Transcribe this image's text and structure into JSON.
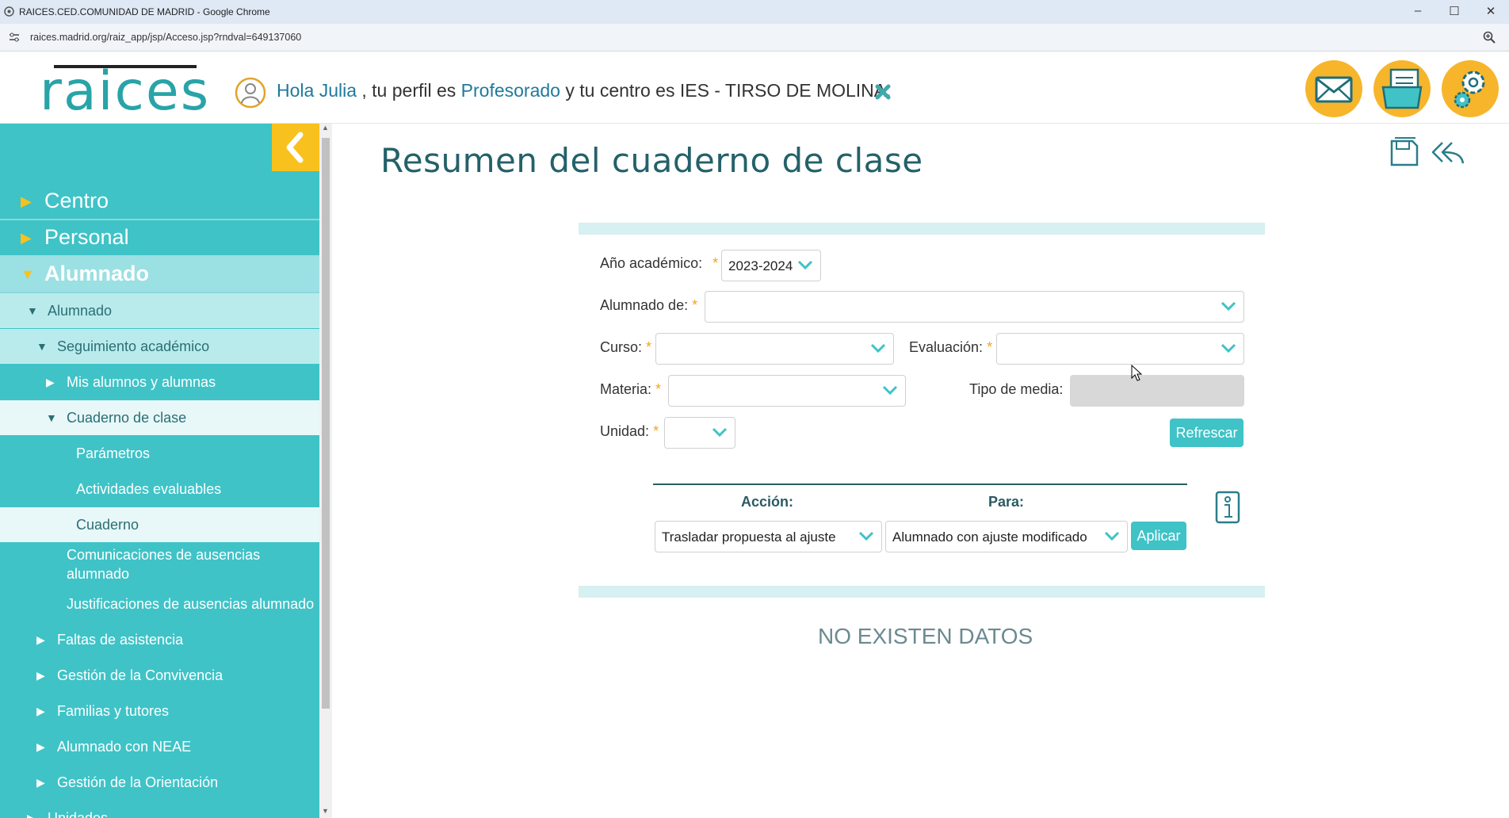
{
  "window": {
    "title": "RAICES.CED.COMUNIDAD DE MADRID - Google Chrome",
    "url": "raices.madrid.org/raiz_app/jsp/Acceso.jsp?rndval=649137060",
    "minimize": "–",
    "maximize": "☐",
    "close": "✕"
  },
  "header": {
    "logo": "raices",
    "greeting": {
      "hola": "Hola Julia",
      "perfil_prefix": ", tu perfil es",
      "perfil": "Profesorado",
      "centro": "y tu centro es IES - TIRSO DE MOLINA."
    },
    "icons": [
      "mail-icon",
      "documents-icon",
      "settings-icon"
    ]
  },
  "sidebar": {
    "collapse_label": "‹",
    "items": [
      {
        "label": "Centro"
      },
      {
        "label": "Personal"
      },
      {
        "label": "Alumnado"
      },
      {
        "label": "Alumnado"
      },
      {
        "label": "Seguimiento académico"
      },
      {
        "label": "Mis alumnos y alumnas"
      },
      {
        "label": "Cuaderno de clase"
      },
      {
        "label": "Parámetros"
      },
      {
        "label": "Actividades evaluables"
      },
      {
        "label": "Cuaderno"
      },
      {
        "label": "Comunicaciones de ausencias alumnado"
      },
      {
        "label": "Justificaciones de ausencias alumnado"
      },
      {
        "label": "Faltas de asistencia"
      },
      {
        "label": "Gestión de la Convivencia"
      },
      {
        "label": "Familias y tutores"
      },
      {
        "label": "Alumnado con NEAE"
      },
      {
        "label": "Gestión de la Orientación"
      },
      {
        "label": "Unidades"
      }
    ]
  },
  "main": {
    "title": "Resumen del cuaderno de clase",
    "form": {
      "anio_label": "Año académico:",
      "anio_value": "2023-2024",
      "alumnado_label": "Alumnado de:",
      "curso_label": "Curso:",
      "evaluacion_label": "Evaluación:",
      "materia_label": "Materia:",
      "tipo_media_label": "Tipo de media:",
      "unidad_label": "Unidad:",
      "required_mark": "*",
      "refrescar": "Refrescar"
    },
    "action_table": {
      "accion_header": "Acción:",
      "para_header": "Para:",
      "accion_value": "Trasladar propuesta al ajuste",
      "para_value": "Alumnado con ajuste modificado",
      "aplicar": "Aplicar"
    },
    "no_data": "NO EXISTEN DATOS"
  },
  "colors": {
    "teal": "#3fc3c7",
    "accent_yellow": "#f9c11d",
    "title": "#24616a"
  }
}
